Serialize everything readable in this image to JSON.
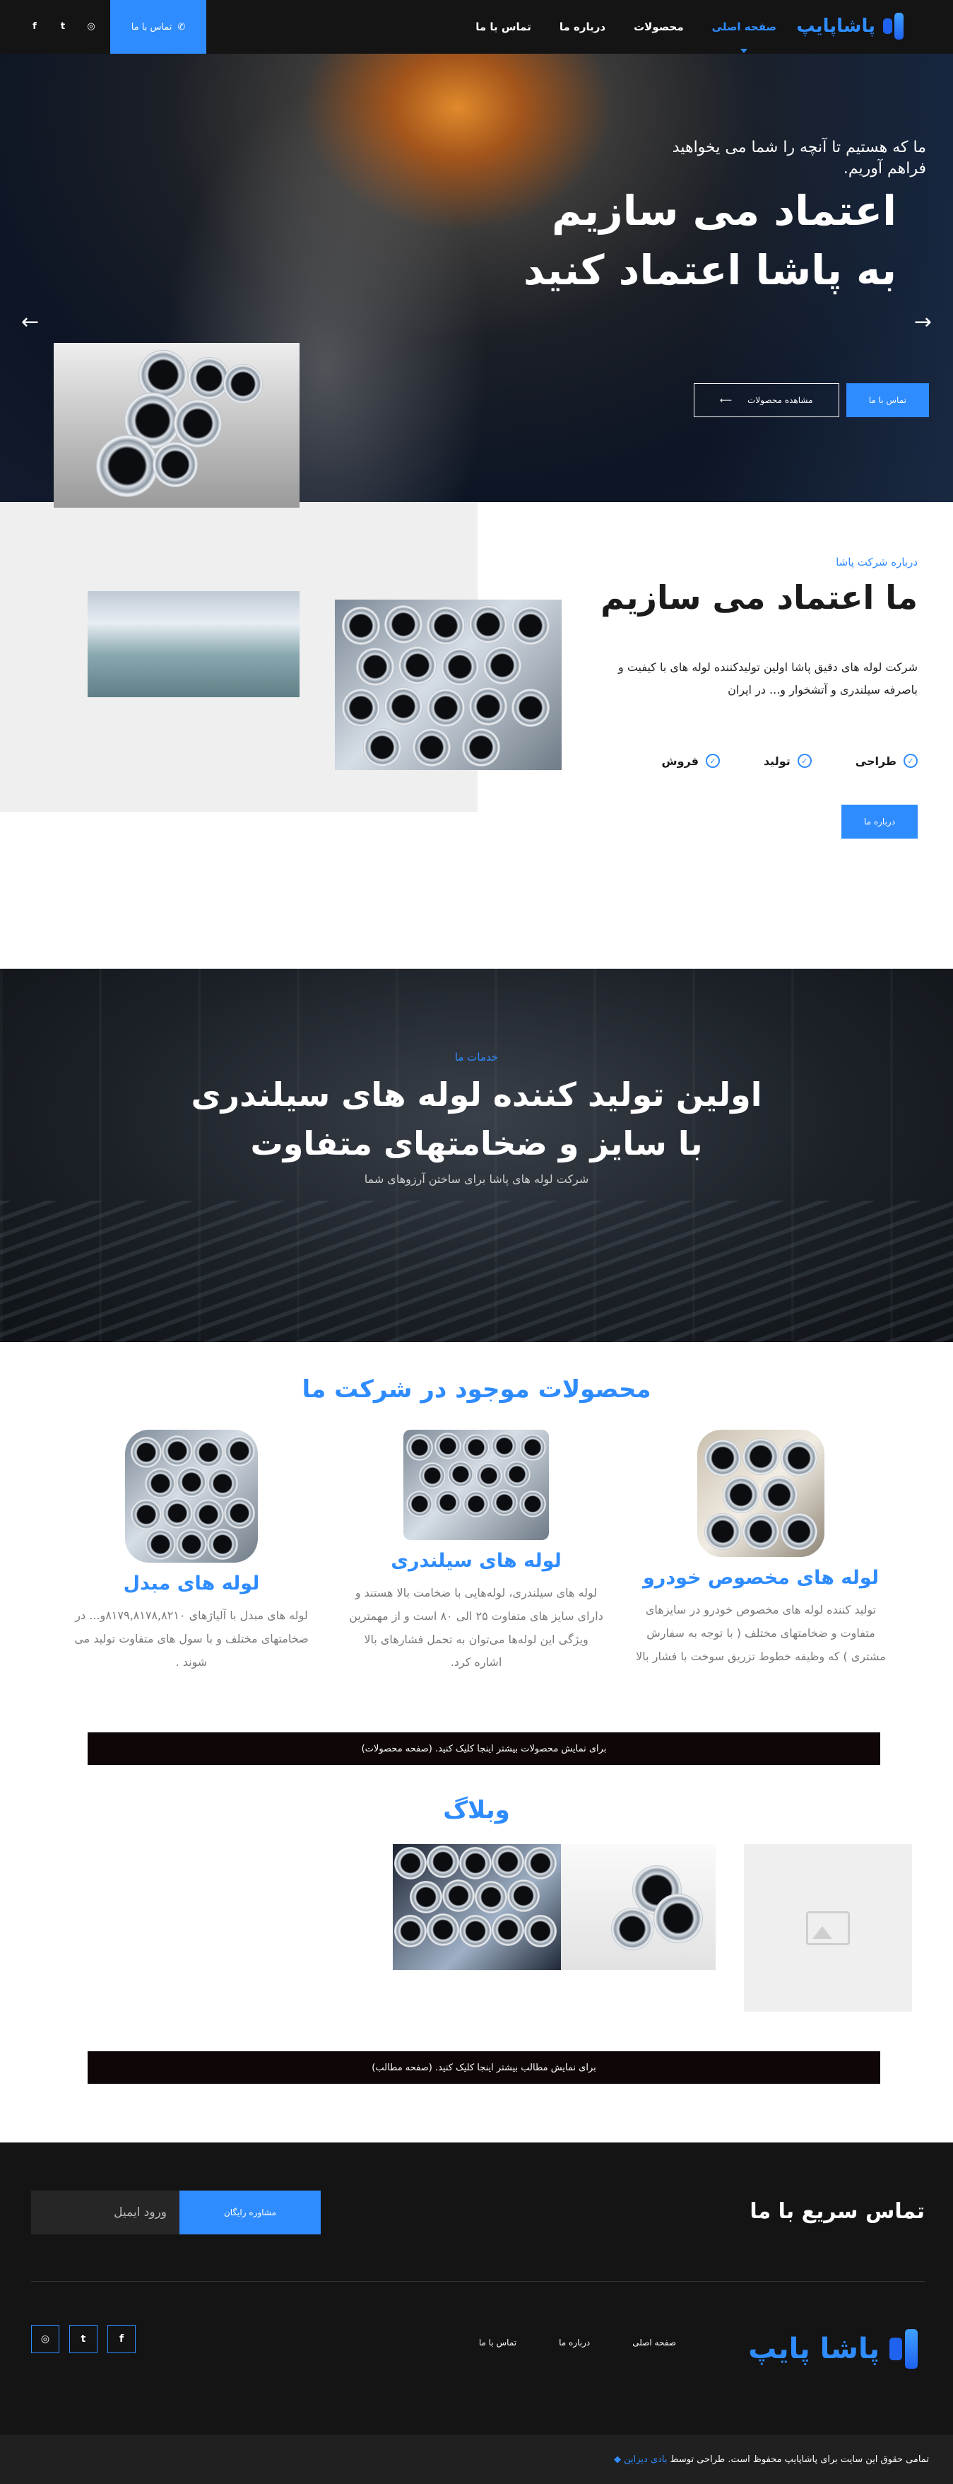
{
  "header": {
    "logo": "پاشاپایپ",
    "nav": [
      "صفحه اصلی",
      "محصولات",
      "درباره ما",
      "تماس با ما"
    ],
    "contact_button": "تماس با ما",
    "social": [
      "instagram-icon",
      "twitter-icon",
      "facebook-icon"
    ]
  },
  "hero": {
    "subtitle": "ما که هستیم تا آنچه را شما می یخواهید فراهم آوریم.",
    "title_line1": "اعتماد می سازیم",
    "title_line2": "به پاشا اعتماد کنید",
    "primary_button": "تماس با ما",
    "secondary_button": "مشاهده محصولات"
  },
  "about": {
    "kicker": "درباره شرکت پاشا",
    "title": "ما اعتماد می سازیم",
    "text": "شرکت لوله های دقیق پاشا اولین تولیدکننده لوله های با کیفیت و باصرفه سیلندری و آتشخوار و... در ایران",
    "features": [
      "طراحی",
      "تولید",
      "فروش"
    ],
    "button": "درباره ما"
  },
  "services": {
    "kicker": "خدمات ما",
    "title_line1": "اولین تولید کننده لوله های سیلندری",
    "title_line2": "با سایز و ضخامتهای متفاوت",
    "subtitle": "شرکت لوله های پاشا برای ساختن آرزوهای شما"
  },
  "products": {
    "title": "محصولات موجود در شرکت ما",
    "items": [
      {
        "name": "لوله های مخصوص خودرو",
        "desc": "تولید کننده لوله های مخصوص خودرو در سایزهای متفاوت و ضخامتهای مختلف ( با توجه به سفارش مشتری ) که وظیفه خطوط تزریق سوخت با فشار بالا"
      },
      {
        "name": "لوله های سیلندری",
        "desc": "لوله های سیلندری، لوله‌هایی با ضخامت بالا هستند و دارای سایز های متفاوت ۲۵ الی ۸۰ است و از مهمترین ویژگی این لوله‌ها می‌توان به تحمل فشارهای بالا اشاره کرد."
      },
      {
        "name": "لوله های مبدل",
        "desc": "لوله های مبدل با آلیاژهای ۸۱۷۹,۸۱۷۸,۸۲۱۰و... در ضخامتهای مختلف و با سول های متفاوت تولید می شوند ."
      }
    ],
    "more_banner": "برای نمایش محصولات بیشتر اینجا کلیک کنید. (صفحه محصولات)"
  },
  "blog": {
    "title": "وبلاگ",
    "more_banner": "برای نمایش مطالب بیشتر اینجا کلیک کنید. (صفحه مطالب)"
  },
  "footer": {
    "quick_title": "تماس سریع با ما",
    "email_placeholder": "ورود ایمیل",
    "consult_button": "مشاوره رایگان",
    "logo": "پاشا پایپ",
    "nav": [
      "صفحه اصلی",
      "درباره ما",
      "تماس با ما"
    ],
    "social": [
      "facebook-icon",
      "twitter-icon",
      "instagram-icon"
    ],
    "copyright": "تمامی حقوق این سایت برای پاشاپایپ محفوظ است. طراحی توسط",
    "designer": "بادی دیزاین"
  },
  "colors": {
    "accent": "#2f8cff",
    "dark": "#141414"
  }
}
